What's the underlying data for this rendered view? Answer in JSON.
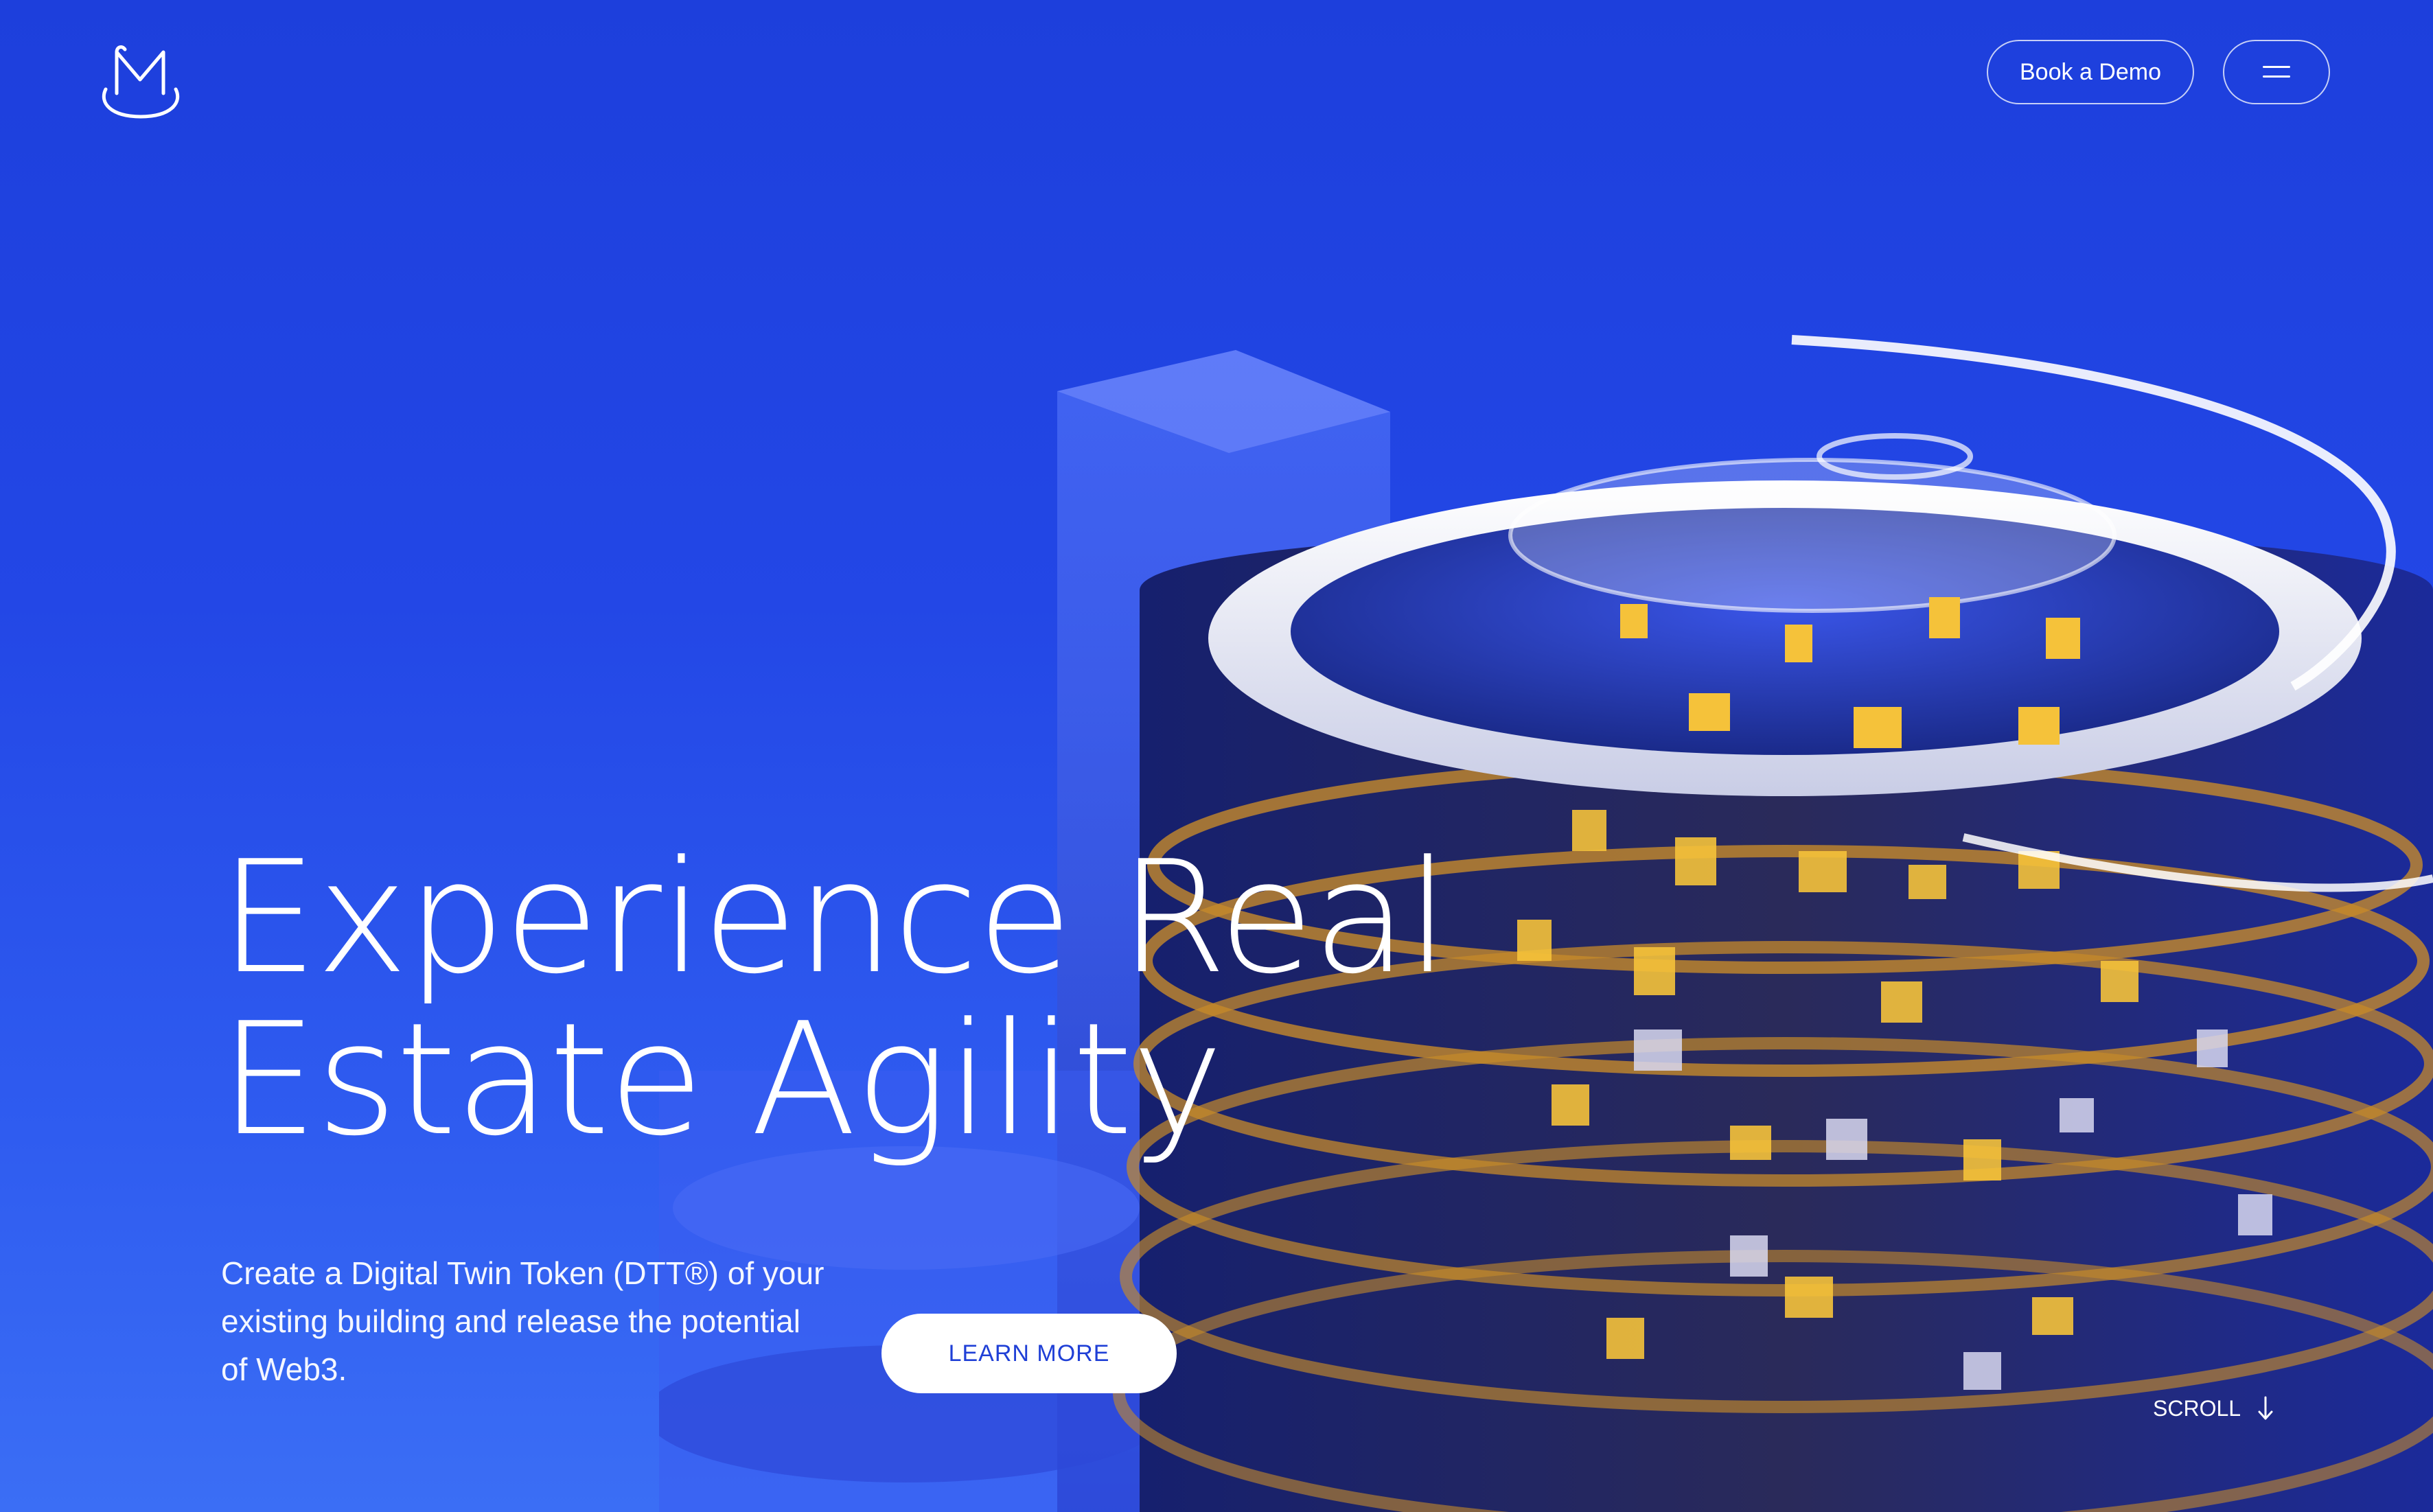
{
  "header": {
    "logo_icon": "m-cup-logo-icon",
    "book_demo_label": "Book a Demo",
    "menu_icon": "hamburger-menu-icon"
  },
  "hero": {
    "headline_line1": "Experience Real",
    "headline_line2": "Estate Agility",
    "subtext": "Create a Digital Twin Token (DTT®) of your existing building and release the potential of Web3.",
    "learn_more_label": "LEARN MORE",
    "scroll_label": "SCROLL",
    "scroll_icon": "arrow-down-icon",
    "illustration": "glass-building-illustration"
  },
  "colors": {
    "background_top": "#1d3fdc",
    "background_bottom": "#3b6ef5",
    "accent_text": "#1f3fd6",
    "window_light": "#f5c23a"
  }
}
